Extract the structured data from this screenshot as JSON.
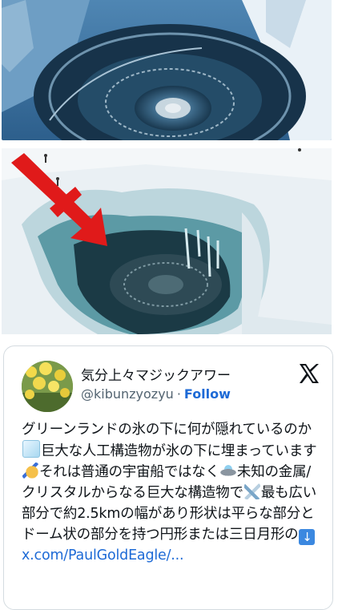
{
  "post": {
    "display_name": "気分上々マジックアワー",
    "handle": "@kibunzyozyu",
    "separator": "·",
    "follow_label": "Follow",
    "text_1": "グリーンランドの氷の下に何が隠れているのか",
    "text_2": "巨大な人工構造物が氷の下に埋まっています",
    "text_3": "それは普通の宇宙船ではなく",
    "text_4": "未知の金属/クリスタルからなる巨大な構造物で",
    "text_5": "最も広い部分で約2.5kmの幅があり形状は平らな部分とドーム状の部分を持つ円形または三日月形の",
    "link_text": "x.com/PaulGoldEagle/..."
  },
  "icons": {
    "brand": "x-logo-icon",
    "emoji_1": "ice-cube-icon",
    "emoji_2": "writing-hand-icon",
    "emoji_3": "flying-saucer-icon",
    "emoji_4": "ice-pick-icon",
    "emoji_5": "down-arrow-icon"
  },
  "colors": {
    "link": "#1d6ad6",
    "arrow": "#e01a1a"
  }
}
